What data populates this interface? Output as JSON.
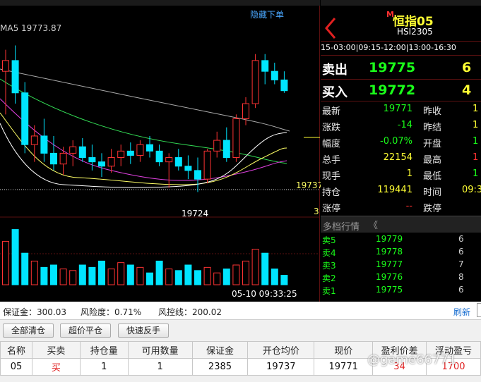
{
  "chart": {
    "hide_orders_label": "隐藏下单",
    "ma_label": "MA5 19773.87",
    "last_price_tag": "19737",
    "low_label": "19724",
    "right_edge_digit": "3",
    "timestamp": "05-10 09:33:25",
    "candles": [
      {
        "o": 19780,
        "h": 19790,
        "l": 19760,
        "c": 19785
      },
      {
        "o": 19785,
        "h": 19792,
        "l": 19765,
        "c": 19770
      },
      {
        "o": 19770,
        "h": 19775,
        "l": 19742,
        "c": 19746
      },
      {
        "o": 19746,
        "h": 19755,
        "l": 19738,
        "c": 19750
      },
      {
        "o": 19750,
        "h": 19758,
        "l": 19738,
        "c": 19742
      },
      {
        "o": 19742,
        "h": 19750,
        "l": 19734,
        "c": 19737
      },
      {
        "o": 19737,
        "h": 19745,
        "l": 19732,
        "c": 19742
      },
      {
        "o": 19742,
        "h": 19748,
        "l": 19736,
        "c": 19745
      },
      {
        "o": 19745,
        "h": 19749,
        "l": 19738,
        "c": 19740
      },
      {
        "o": 19740,
        "h": 19746,
        "l": 19734,
        "c": 19738
      },
      {
        "o": 19738,
        "h": 19742,
        "l": 19731,
        "c": 19736
      },
      {
        "o": 19736,
        "h": 19744,
        "l": 19733,
        "c": 19740
      },
      {
        "o": 19740,
        "h": 19746,
        "l": 19736,
        "c": 19743
      },
      {
        "o": 19743,
        "h": 19747,
        "l": 19737,
        "c": 19741
      },
      {
        "o": 19741,
        "h": 19748,
        "l": 19738,
        "c": 19746
      },
      {
        "o": 19746,
        "h": 19750,
        "l": 19740,
        "c": 19743
      },
      {
        "o": 19743,
        "h": 19746,
        "l": 19736,
        "c": 19738
      },
      {
        "o": 19738,
        "h": 19742,
        "l": 19726,
        "c": 19740
      },
      {
        "o": 19740,
        "h": 19744,
        "l": 19734,
        "c": 19736
      },
      {
        "o": 19736,
        "h": 19741,
        "l": 19730,
        "c": 19734
      },
      {
        "o": 19734,
        "h": 19740,
        "l": 19724,
        "c": 19730
      },
      {
        "o": 19730,
        "h": 19744,
        "l": 19728,
        "c": 19743
      },
      {
        "o": 19743,
        "h": 19752,
        "l": 19740,
        "c": 19748
      },
      {
        "o": 19748,
        "h": 19754,
        "l": 19738,
        "c": 19740
      },
      {
        "o": 19740,
        "h": 19760,
        "l": 19738,
        "c": 19758
      },
      {
        "o": 19758,
        "h": 19768,
        "l": 19755,
        "c": 19765
      },
      {
        "o": 19765,
        "h": 19788,
        "l": 19763,
        "c": 19785
      },
      {
        "o": 19785,
        "h": 19788,
        "l": 19774,
        "c": 19780
      },
      {
        "o": 19780,
        "h": 19784,
        "l": 19774,
        "c": 19776
      },
      {
        "o": 19776,
        "h": 19780,
        "l": 19770,
        "c": 19771
      }
    ],
    "volumes": [
      55,
      70,
      40,
      30,
      22,
      25,
      20,
      18,
      25,
      22,
      30,
      20,
      28,
      25,
      22,
      15,
      30,
      20,
      18,
      25,
      18,
      22,
      15,
      20,
      25,
      30,
      45,
      40,
      20,
      12
    ]
  },
  "quote": {
    "code_marker": "M",
    "name": "恒指05",
    "code": "HSI2305",
    "session_times": "15-03:00|09:15-12:00|13:00-16:30",
    "sell_label": "卖出",
    "sell_price": "19775",
    "sell_qty": "6",
    "buy_label": "买入",
    "buy_price": "19772",
    "buy_qty": "4",
    "rows": [
      {
        "l1": "最新",
        "v1": "19771",
        "c1": "green",
        "l2": "昨收",
        "v2": "1"
      },
      {
        "l1": "涨跌",
        "v1": "-14",
        "c1": "green",
        "l2": "昨结",
        "v2": "1"
      },
      {
        "l1": "幅度",
        "v1": "-0.07%",
        "c1": "green",
        "l2": "开盘",
        "v2": "1"
      },
      {
        "l1": "总手",
        "v1": "22154",
        "c1": "yellow",
        "l2": "最高",
        "v2": "1"
      },
      {
        "l1": "现手",
        "v1": "1",
        "c1": "yellow",
        "l2": "最低",
        "v2": "1"
      },
      {
        "l1": "持仓",
        "v1": "119441",
        "c1": "yellow",
        "l2": "时间",
        "v2": "09:3"
      },
      {
        "l1": "涨停",
        "v1": "--",
        "c1": "red",
        "l2": "跌停",
        "v2": ""
      }
    ],
    "depth_label": "多档行情",
    "depth": [
      {
        "label": "卖5",
        "price": "19779",
        "qty": "6"
      },
      {
        "label": "卖4",
        "price": "19778",
        "qty": "6"
      },
      {
        "label": "卖3",
        "price": "19777",
        "qty": "7"
      },
      {
        "label": "卖2",
        "price": "19776",
        "qty": "8"
      },
      {
        "label": "卖1",
        "price": "19775",
        "qty": "6"
      }
    ]
  },
  "account": {
    "margin_text": "保证金：300.03",
    "risk_text": "风险度：0.71%",
    "risk_line_text": "风控线：200.02",
    "refresh_label": "刷新",
    "buttons": [
      "全部清仓",
      "超价平仓",
      "快速反手"
    ]
  },
  "positions": {
    "headers": [
      "名称",
      "买卖",
      "持仓量",
      "可用数量",
      "保证金",
      "开仓均价",
      "现价",
      "盈利价差",
      "浮动盈亏"
    ],
    "row": [
      "05",
      "买",
      "1",
      "1",
      "2385",
      "19737",
      "19771",
      "34",
      "1700"
    ]
  },
  "watermark": "@game66771"
}
